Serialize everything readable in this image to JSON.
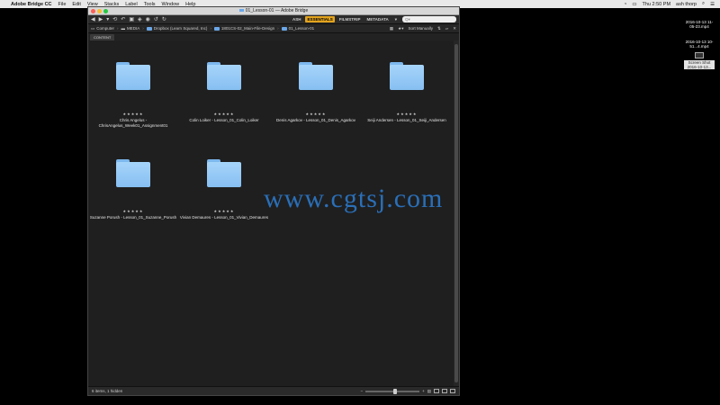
{
  "menubar": {
    "app_name": "Adobe Bridge CC",
    "items": [
      "File",
      "Edit",
      "View",
      "Stacks",
      "Label",
      "Tools",
      "Window",
      "Help"
    ],
    "clock": "Thu 2:50 PM",
    "user": "ash thorp"
  },
  "desktop_files": [
    {
      "label": "2016-10-13 11-05-23.mp4"
    },
    {
      "label": "2016-10-13 10-51...4.mp4"
    },
    {
      "label": "Screen Shot 2016-10-13..."
    }
  ],
  "window": {
    "title": "01_Lesson-01 — Adobe Bridge",
    "workspaces": [
      "ASH",
      "ESSENTIALS",
      "FILMSTRIP",
      "METADATA"
    ],
    "active_workspace": "ESSENTIALS",
    "search_placeholder": "Q▾",
    "breadcrumb": [
      "Computer",
      "MEDIA",
      "Dropbox (Learn Squared, Inc)",
      "1801CS-02_Main-File-Design",
      "01_Lesson-01"
    ],
    "sort_label": "Sort Manually",
    "panel_tab": "CONTENT",
    "status": "6 items, 1 hidden",
    "zoom_level": 0.55,
    "items": [
      {
        "name": "Chris Angelus - ChrisAngelus_Week01_Assignment01",
        "rating": "★★★★★"
      },
      {
        "name": "Colin Loiker - Lesson_01_Colin_Loiker",
        "rating": "★★★★★"
      },
      {
        "name": "Denis Agarkov - Lesson_01_Denis_Agarkov",
        "rating": "★★★★★"
      },
      {
        "name": "Seiji Andersen - Lesson_01_Seiji_Andersen",
        "rating": "★★★★★"
      },
      {
        "name": "Suzanne Porush - Lesson_01_Suzanne_Porush",
        "rating": "★★★★★"
      },
      {
        "name": "Vivian Demaures - Lesson_01_Vivian_Demaures",
        "rating": "★★★★★"
      }
    ]
  },
  "watermark": "www.cgtsj.com",
  "colors": {
    "accent": "#e3a41e",
    "folder": "#86bff2",
    "watermark": "#2a6fb8"
  }
}
